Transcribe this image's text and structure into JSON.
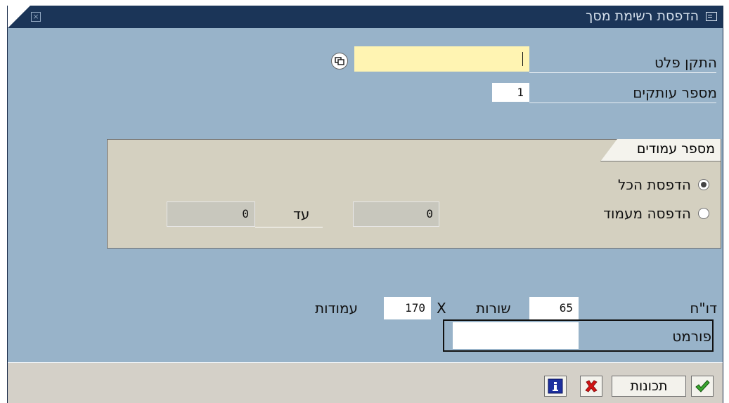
{
  "window": {
    "title": "הדפסת רשימת מסך"
  },
  "output_device": {
    "label": "התקן פלט",
    "value": ""
  },
  "copies": {
    "label": "מספר עותקים",
    "value": "1"
  },
  "pages_group": {
    "title": "מספר עמודים",
    "print_all_label": "הדפסת הכל",
    "print_from_label": "הדפסה מעמוד",
    "from_value": "0",
    "to_label": "עד",
    "to_value": "0",
    "selected": "print_all"
  },
  "report": {
    "label": "דו\"ח",
    "rows_value": "65",
    "rows_label": "שורות",
    "x": "X",
    "cols_value": "170",
    "cols_label": "עמודות"
  },
  "format": {
    "label": "פורמט",
    "value": ""
  },
  "footer": {
    "properties_label": "תכונות"
  },
  "colors": {
    "title_bar": "#1b3558",
    "background": "#98b3c9",
    "input_required": "#fff4b2",
    "group_bg": "#d4d0c0"
  }
}
